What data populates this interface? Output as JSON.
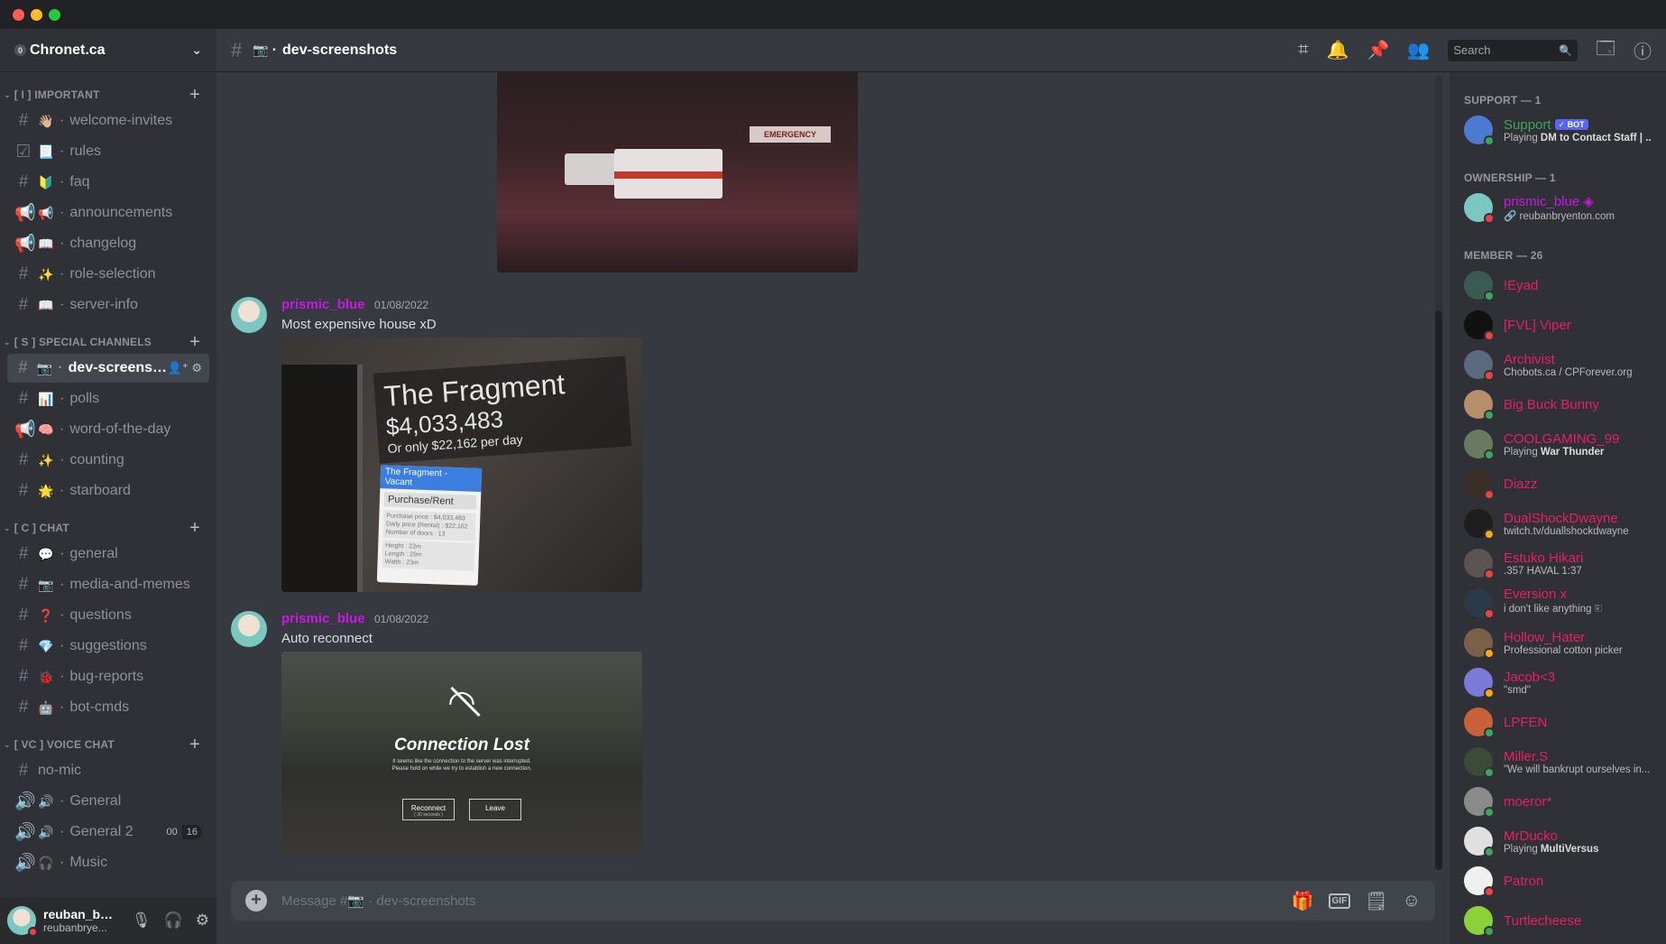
{
  "guild": {
    "badge": "0",
    "name": "Chronet.ca"
  },
  "sidebar": {
    "categories": [
      {
        "label": "[ I ] IMPORTANT",
        "channels": [
          {
            "type": "#",
            "emoji": "👋🏼",
            "name": "welcome-invites"
          },
          {
            "type": "☑",
            "emoji": "📃",
            "name": "rules"
          },
          {
            "type": "#",
            "emoji": "🔰",
            "name": "faq"
          },
          {
            "type": "📢",
            "emoji": "📢",
            "name": "announcements"
          },
          {
            "type": "📢",
            "emoji": "📖",
            "name": "changelog"
          },
          {
            "type": "#",
            "emoji": "✨",
            "name": "role-selection"
          },
          {
            "type": "#",
            "emoji": "📖",
            "name": "server-info"
          }
        ]
      },
      {
        "label": "[ S ] SPECIAL CHANNELS",
        "channels": [
          {
            "type": "#",
            "emoji": "📷",
            "name": "dev-screensh...",
            "active": true
          },
          {
            "type": "#",
            "emoji": "📊",
            "name": "polls"
          },
          {
            "type": "📢",
            "emoji": "🧠",
            "name": "word-of-the-day"
          },
          {
            "type": "#",
            "emoji": "✨",
            "name": "counting"
          },
          {
            "type": "#",
            "emoji": "🌟",
            "name": "starboard"
          }
        ]
      },
      {
        "label": "[ C ] CHAT",
        "channels": [
          {
            "type": "#",
            "emoji": "💬",
            "name": "general"
          },
          {
            "type": "#",
            "emoji": "📷",
            "name": "media-and-memes"
          },
          {
            "type": "#",
            "emoji": "❓",
            "name": "questions"
          },
          {
            "type": "#",
            "emoji": "💎",
            "name": "suggestions"
          },
          {
            "type": "#",
            "emoji": "🐞",
            "name": "bug-reports"
          },
          {
            "type": "#",
            "emoji": "🤖",
            "name": "bot-cmds"
          }
        ]
      },
      {
        "label": "[ VC ] VOICE CHAT",
        "channels": [
          {
            "type": "#",
            "emoji": "",
            "name": "no-mic"
          },
          {
            "type": "🔊",
            "emoji": "🔊",
            "name": "General"
          },
          {
            "type": "🔊",
            "emoji": "🔊",
            "name": "General 2",
            "badge": [
              "00",
              "16"
            ]
          },
          {
            "type": "🔊",
            "emoji": "🎧",
            "name": "Music"
          }
        ]
      }
    ]
  },
  "user": {
    "name": "reuban_bry...",
    "status": "reubanbrye..."
  },
  "header": {
    "emoji": "📷",
    "dot": "·",
    "channel": "dev-screenshots",
    "search_placeholder": "Search"
  },
  "messages": [
    {
      "author": "prismic_blue",
      "time": "01/08/2022",
      "text": "Most expensive house xD",
      "image": {
        "title": "The Fragment",
        "price": "$4,033,483",
        "daily": "Or only $22,162 per day",
        "panel_head": "The Fragment - Vacant",
        "panel_btn": "Purchase/Rent",
        "panel_info": "Purchase price : $4,033,483\nDaily price (Rental) : $22,162\nNumber of doors : 13",
        "panel_dims": "Height : 22m\nLength : 29m\nWidth : 23m"
      }
    },
    {
      "author": "prismic_blue",
      "time": "01/08/2022",
      "text": "Auto reconnect",
      "image": {
        "title": "Connection Lost",
        "sub": "It seems like the connection to the server was interrupted.\nPlease hold on while we try to establish a new connection.",
        "btn_reconnect": "Reconnect",
        "btn_reconnect_sub": "( 30 seconds )",
        "btn_leave": "Leave"
      }
    }
  ],
  "first_image": {
    "sign": "EMERGENCY"
  },
  "composer": {
    "placeholder": "Message #📷 · dev-screenshots",
    "gif": "GIF"
  },
  "members": {
    "groups": [
      {
        "label": "SUPPORT — 1",
        "members": [
          {
            "name": "Support",
            "color": "#3ba55c",
            "bot": "✓ BOT",
            "sub_pre": "Playing ",
            "sub_bold": "DM to Contact Staff | ...",
            "status": "online",
            "av": "#4a7bd1"
          }
        ]
      },
      {
        "label": "OWNERSHIP — 1",
        "members": [
          {
            "name": "prismic_blue ◈",
            "color": "#c719e0",
            "sub_pre": "🔗 reubanbryenton.com",
            "sub_bold": "",
            "status": "dnd",
            "av": "#7bc8c0"
          }
        ]
      },
      {
        "label": "MEMBER — 26",
        "members": [
          {
            "name": "!Eyad",
            "color": "#e91e63",
            "sub_pre": "",
            "sub_bold": "",
            "status": "online",
            "av": "#3a5a52"
          },
          {
            "name": "[FVL] Viper",
            "color": "#e91e63",
            "sub_pre": "",
            "sub_bold": "",
            "status": "dnd",
            "av": "#111111"
          },
          {
            "name": "Archivist",
            "color": "#e91e63",
            "sub_pre": "Chobots.ca / CPForever.org",
            "sub_bold": "",
            "status": "dnd",
            "av": "#5a6a7e"
          },
          {
            "name": "Big Buck Bunny",
            "color": "#e91e63",
            "sub_pre": "",
            "sub_bold": "",
            "status": "online",
            "av": "#b58e6a"
          },
          {
            "name": "COOLGAMING_99",
            "color": "#e91e63",
            "sub_pre": "Playing ",
            "sub_bold": "War Thunder",
            "status": "online",
            "av": "#6a7a62"
          },
          {
            "name": "Diazz",
            "color": "#e91e63",
            "sub_pre": "",
            "sub_bold": "",
            "status": "dnd",
            "av": "#3a2f28"
          },
          {
            "name": "DualShockDwayne",
            "color": "#e91e63",
            "sub_pre": "twitch.tv/duallshockdwayne",
            "sub_bold": "",
            "status": "idle",
            "av": "#1e1e1e"
          },
          {
            "name": "Estuko Hikari",
            "color": "#e91e63",
            "sub_pre": ".357 HAVAL 1:37",
            "sub_bold": "",
            "status": "dnd",
            "av": "#5c5450"
          },
          {
            "name": "Eversion x",
            "color": "#e91e63",
            "sub_pre": "i don't like anything 🗉",
            "sub_bold": "",
            "status": "dnd",
            "av": "#2a3a4a"
          },
          {
            "name": "Hollow_Hater",
            "color": "#e91e63",
            "sub_pre": "Professional cotton picker",
            "sub_bold": "",
            "status": "idle",
            "av": "#7a6048"
          },
          {
            "name": "Jacob<3",
            "color": "#e91e63",
            "sub_pre": "\"smd\"",
            "sub_bold": "",
            "status": "idle",
            "av": "#7a7ad8"
          },
          {
            "name": "LPFEN",
            "color": "#e91e63",
            "sub_pre": "",
            "sub_bold": "",
            "status": "online",
            "av": "#c8603a"
          },
          {
            "name": "Miller.S",
            "color": "#e91e63",
            "sub_pre": "\"We will bankrupt ourselves in...",
            "sub_bold": "",
            "status": "online",
            "av": "#3c4a38"
          },
          {
            "name": "moeror*",
            "color": "#e91e63",
            "sub_pre": "",
            "sub_bold": "",
            "status": "online",
            "av": "#8a8a8a"
          },
          {
            "name": "MrDucko",
            "color": "#e91e63",
            "sub_pre": "Playing ",
            "sub_bold": "MultiVersus",
            "status": "online",
            "av": "#e0e0e0"
          },
          {
            "name": "Patron",
            "color": "#e91e63",
            "sub_pre": "",
            "sub_bold": "",
            "status": "dnd",
            "av": "#f0f0f0"
          },
          {
            "name": "Turtlecheese",
            "color": "#e91e63",
            "sub_pre": "",
            "sub_bold": "",
            "status": "online",
            "av": "#8bd13a"
          }
        ]
      }
    ]
  }
}
